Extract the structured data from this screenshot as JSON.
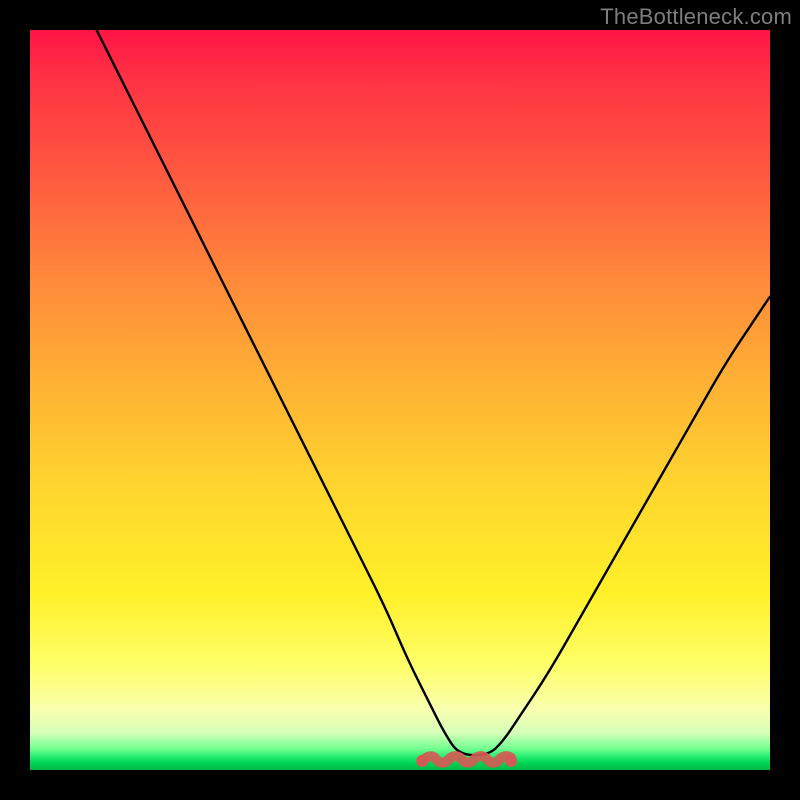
{
  "watermark": "TheBottleneck.com",
  "chart_data": {
    "type": "line",
    "title": "",
    "xlabel": "",
    "ylabel": "",
    "xlim": [
      0,
      100
    ],
    "ylim": [
      0,
      100
    ],
    "series": [
      {
        "name": "bottleneck-curve",
        "x": [
          9,
          12,
          16,
          20,
          24,
          28,
          32,
          36,
          40,
          44,
          48,
          51,
          54,
          56,
          58,
          62,
          64,
          66,
          70,
          74,
          78,
          82,
          86,
          90,
          94,
          98,
          100
        ],
        "values": [
          100,
          94,
          86,
          78,
          70,
          62,
          54,
          46,
          38,
          30,
          22,
          15,
          9,
          5,
          2,
          2,
          4,
          7,
          13,
          20,
          27,
          34,
          41,
          48,
          55,
          61,
          64
        ]
      }
    ],
    "markers": [
      {
        "name": "valley-marker",
        "type": "scribble",
        "color": "#d45a55",
        "x_start": 53,
        "x_end": 65,
        "y": 1.5
      }
    ],
    "colors": {
      "curve": "#000000",
      "marker": "#d45a55",
      "frame": "#000000",
      "gradient_top": "#ff1446",
      "gradient_bottom": "#00b845"
    }
  }
}
